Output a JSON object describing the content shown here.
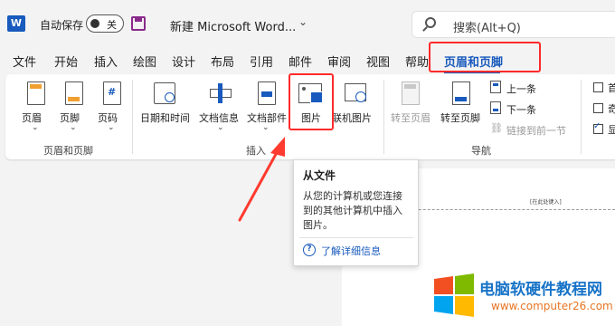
{
  "titlebar": {
    "app_letter": "W",
    "autosave_label": "自动保存",
    "autosave_state": "关",
    "doc_title": "新建 Microsoft Word...",
    "title_chevron": "⌄",
    "search_placeholder": "搜索(Alt+Q)"
  },
  "tabs": [
    "文件",
    "开始",
    "插入",
    "绘图",
    "设计",
    "布局",
    "引用",
    "邮件",
    "审阅",
    "视图",
    "帮助",
    "页眉和页脚"
  ],
  "ribbon": {
    "groups": {
      "hf": "页眉和页脚",
      "insert": "插入",
      "nav": "导航"
    },
    "buttons": {
      "header": "页眉",
      "footer": "页脚",
      "page_number": "页码",
      "date_time": "日期和时间",
      "doc_info": "文档信息",
      "doc_parts": "文档部件",
      "picture": "图片",
      "online_picture": "联机图片",
      "goto_header": "转至页眉",
      "goto_footer": "转至页脚",
      "previous": "上一条",
      "next": "下一条",
      "link_previous": "链接到前一节"
    },
    "options": [
      "首",
      "奇",
      "显"
    ],
    "page_number_glyph": "#"
  },
  "tooltip": {
    "title": "从文件",
    "description": "从您的计算机或您连接到的其他计算机中插入图片。",
    "link_icon": "?",
    "link": "了解详细信息"
  },
  "document": {
    "header_placeholder": "[在此处键入]"
  },
  "watermark": {
    "text": "电脑软硬件教程网",
    "url": "www.computer26.com"
  },
  "colors": {
    "accent": "#185abd",
    "highlight": "#ff2a2a",
    "arrow": "#ff3b30"
  }
}
